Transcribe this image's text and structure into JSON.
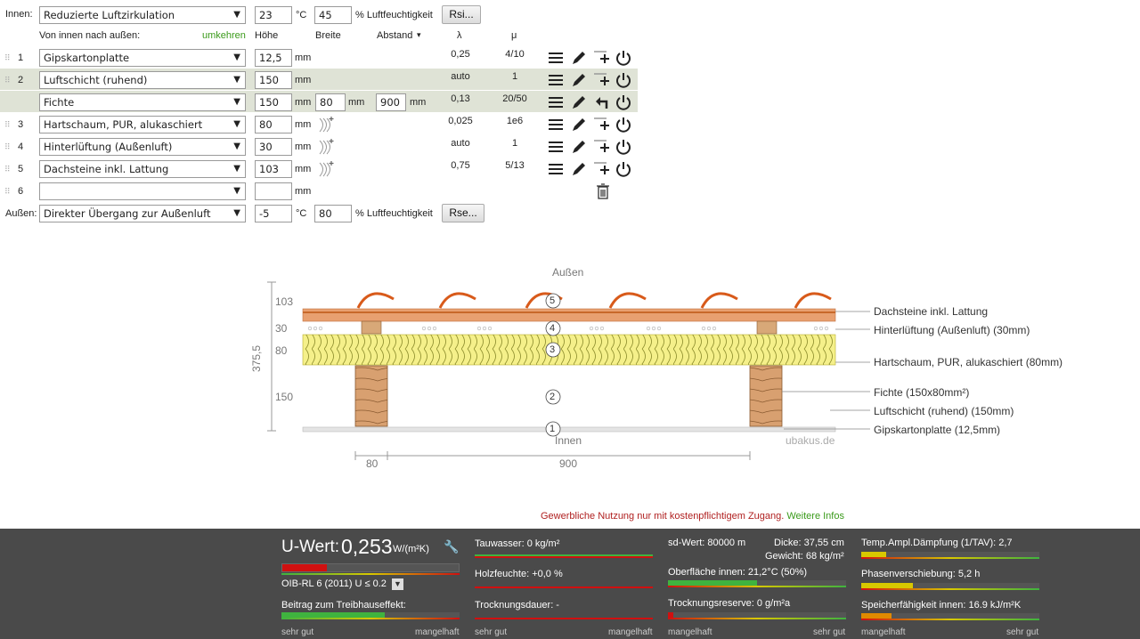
{
  "inside": {
    "label": "Innen:",
    "select": "Reduzierte Luftzirkulation",
    "temp": "23",
    "temp_unit": "°C",
    "humidity": "45",
    "humidity_unit": "% Luftfeuchtigkeit",
    "button": "Rsi..."
  },
  "outside": {
    "label": "Außen:",
    "select": "Direkter Übergang zur Außenluft",
    "temp": "-5",
    "temp_unit": "°C",
    "humidity": "80",
    "humidity_unit": "% Luftfeuchtigkeit",
    "button": "Rse..."
  },
  "headers": {
    "direction": "Von innen nach außen:",
    "reverse": "umkehren",
    "height": "Höhe",
    "width": "Breite",
    "spacing": "Abstand",
    "spacing_arrow": "▾",
    "lambda": "λ",
    "mu": "μ"
  },
  "unit_mm": "mm",
  "layers": [
    {
      "num": "1",
      "material": "Gipskartonplatte",
      "height": "12,5",
      "lambda": "0,25",
      "mu": "4/10"
    },
    {
      "num": "2",
      "material": "Luftschicht (ruhend)",
      "height": "150",
      "lambda": "auto",
      "mu": "1"
    },
    {
      "num": "",
      "material": "Fichte",
      "height": "150",
      "width": "80",
      "spacing": "900",
      "lambda": "0,13",
      "mu": "20/50"
    },
    {
      "num": "3",
      "material": "Hartschaum, PUR, alukaschiert",
      "height": "80",
      "lambda": "0,025",
      "mu": "1e6"
    },
    {
      "num": "4",
      "material": "Hinterlüftung (Außenluft)",
      "height": "30",
      "lambda": "auto",
      "mu": "1"
    },
    {
      "num": "5",
      "material": "Dachsteine inkl. Lattung",
      "height": "103",
      "lambda": "0,75",
      "mu": "5/13"
    },
    {
      "num": "6",
      "material": "",
      "height": ""
    }
  ],
  "diagram": {
    "top_label": "Außen",
    "bottom_label": "Innen",
    "watermark": "ubakus.de",
    "total": "375,5",
    "dims": [
      "103",
      "30",
      "80",
      "150"
    ],
    "bottom_dims": [
      "80",
      "900"
    ],
    "circles": [
      "5",
      "4",
      "3",
      "2",
      "1"
    ],
    "legend": [
      "Dachsteine inkl. Lattung",
      "Hinterlüftung (Außenluft) (30mm)",
      "Hartschaum, PUR, alukaschiert (80mm)",
      "Fichte (150x80mm²)",
      "Luftschicht (ruhend) (150mm)",
      "Gipskartonplatte (12,5mm)"
    ]
  },
  "notice": {
    "text": "Gewerbliche Nutzung nur mit kostenpflichtigem Zugang.",
    "link": "Weitere Infos"
  },
  "results": {
    "u_label": "U-Wert:",
    "u_value": "0,253",
    "u_unit": "W/(m²K)",
    "oib": "OIB-RL 6 (2011) U ≤ 0.2",
    "greenhouse": "Beitrag zum Treibhauseffekt:",
    "tauwasser": "Tauwasser: 0 kg/m²",
    "holzfeuchte": "Holzfeuchte: +0,0 %",
    "trocknungsdauer": "Trocknungsdauer: -",
    "sd": "sd-Wert: 80000 m",
    "dicke": "Dicke: 37,55 cm",
    "gewicht": "Gewicht: 68 kg/m²",
    "oberflaeche": "Oberfläche innen: 21,2°C (50%)",
    "trocknungsreserve": "Trocknungsreserve: 0 g/m²a",
    "temp_ampl": "Temp.Ampl.Dämpfung (1/TAV): 2,7",
    "phasen": "Phasenverschiebung: 5,2 h",
    "speicher": "Speicherfähigkeit innen: 16.9 kJ/m²K",
    "scale_good": "sehr gut",
    "scale_bad": "mangelhaft",
    "colors": {
      "green": "#3fb33f",
      "red": "#d01010",
      "yellow": "#d8c800",
      "orange": "#e08a00"
    }
  }
}
